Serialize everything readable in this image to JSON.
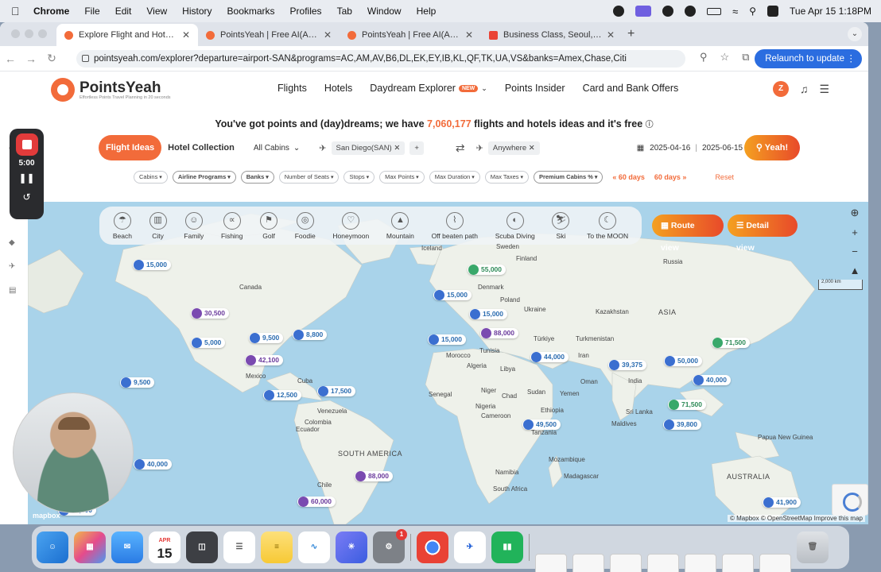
{
  "menubar": {
    "app": "Chrome",
    "items": [
      "File",
      "Edit",
      "View",
      "History",
      "Bookmarks",
      "Profiles",
      "Tab",
      "Window",
      "Help"
    ],
    "clock": "Tue Apr 15  1:18PM"
  },
  "tabs": [
    {
      "title": "Explore Flight and Hotel deals",
      "active": true
    },
    {
      "title": "PointsYeah | Free AI(All Inclus",
      "active": false
    },
    {
      "title": "PointsYeah | Free AI(All Inclus",
      "active": false
    },
    {
      "title": "Business Class, Seoul, So",
      "active": false
    }
  ],
  "address": {
    "url": "pointsyeah.com/explorer?departure=airport-SAN&programs=AC,AM,AV,B6,DL,EK,EY,IB,KL,QF,TK,UA,VS&banks=Amex,Chase,Citi",
    "relaunch": "Relaunch to update"
  },
  "site": {
    "logo_name": "PointsYeah",
    "logo_tagline": "Effortless Points Travel Planning in 20 seconds",
    "nav": [
      "Flights",
      "Hotels",
      "Daydream Explorer",
      "Points Insider",
      "Card and Bank Offers"
    ],
    "new_badge": "NEW",
    "avatar_letter": "Z",
    "tagline_pre": "You've got points and (day)dreams; we have",
    "tagline_num": "7,060,177",
    "tagline_post": "flights and hotels ideas and it's free",
    "search": {
      "flight_ideas": "Flight Ideas",
      "hotel_collection": "Hotel Collection",
      "cabins": "All Cabins",
      "origin": "San Diego(SAN)",
      "destination": "Anywhere",
      "date_from": "2025-04-16",
      "date_to": "2025-06-15",
      "go": "Yeah!"
    },
    "filters": [
      "Cabins",
      "Airline Programs",
      "Banks",
      "Number of Seats",
      "Stops",
      "Max Points",
      "Max Duration",
      "Max Taxes",
      "Premium Cabins %"
    ],
    "days_prev": "« 60 days",
    "days_next": "60 days »",
    "reset": "Reset"
  },
  "categories": [
    "Beach",
    "City",
    "Family",
    "Fishing",
    "Golf",
    "Foodie",
    "Honeymoon",
    "Mountain",
    "Off beaten path",
    "Scuba Diving",
    "Ski",
    "To the MOON"
  ],
  "views": {
    "route": "Route view",
    "detail": "Detail view"
  },
  "scale": "2,000 km",
  "attribution": "© Mapbox © OpenStreetMap  Improve this map",
  "mapbox_logo": "mapbox",
  "recorder": {
    "time": "5:00"
  },
  "places": [
    "Iceland",
    "Sweden",
    "Finland",
    "Russia",
    "Canada",
    "Denmark",
    "Poland",
    "Ukraine",
    "Kazakhstan",
    "ASIA",
    "Türkiye",
    "Turkmenistan",
    "Tunisia",
    "Morocco",
    "Algeria",
    "Libya",
    "Iran",
    "Mexico",
    "Cuba",
    "Venezuela",
    "Colombia",
    "Ecuador",
    "Senegal",
    "Niger",
    "Chad",
    "Sudan",
    "Oman",
    "Yemen",
    "India",
    "Nigeria",
    "Cameroon",
    "Ethiopia",
    "Sri Lanka",
    "Maldives",
    "Tanzania",
    "Papua New Guinea",
    "SOUTH AMERICA",
    "Chile",
    "Mozambique",
    "Namibia",
    "South Africa",
    "Madagascar",
    "AUSTRALIA"
  ],
  "pins": [
    {
      "value": "15,000",
      "type": "blue"
    },
    {
      "value": "55,000",
      "type": "green"
    },
    {
      "value": "15,000",
      "type": "blue"
    },
    {
      "value": "15,000",
      "type": "blue"
    },
    {
      "value": "30,500",
      "type": "purple"
    },
    {
      "value": "5,000",
      "type": "blue"
    },
    {
      "value": "9,500",
      "type": "blue"
    },
    {
      "value": "8,800",
      "type": "blue"
    },
    {
      "value": "15,000",
      "type": "blue"
    },
    {
      "value": "88,000",
      "type": "purple"
    },
    {
      "value": "71,500",
      "type": "green"
    },
    {
      "value": "42,100",
      "type": "purple"
    },
    {
      "value": "44,000",
      "type": "blue"
    },
    {
      "value": "39,375",
      "type": "blue"
    },
    {
      "value": "50,000",
      "type": "blue"
    },
    {
      "value": "9,500",
      "type": "blue"
    },
    {
      "value": "40,000",
      "type": "blue"
    },
    {
      "value": "17,500",
      "type": "blue"
    },
    {
      "value": "12,500",
      "type": "blue"
    },
    {
      "value": "71,500",
      "type": "green"
    },
    {
      "value": "49,500",
      "type": "blue"
    },
    {
      "value": "39,800",
      "type": "blue"
    },
    {
      "value": "40,000",
      "type": "blue"
    },
    {
      "value": "88,000",
      "type": "purple"
    },
    {
      "value": "60,000",
      "type": "purple"
    },
    {
      "value": "41,900",
      "type": "blue"
    },
    {
      "value": "70,000",
      "type": "blue"
    }
  ],
  "dock": {
    "calendar_month": "APR",
    "calendar_day": "15",
    "badge": "1"
  }
}
